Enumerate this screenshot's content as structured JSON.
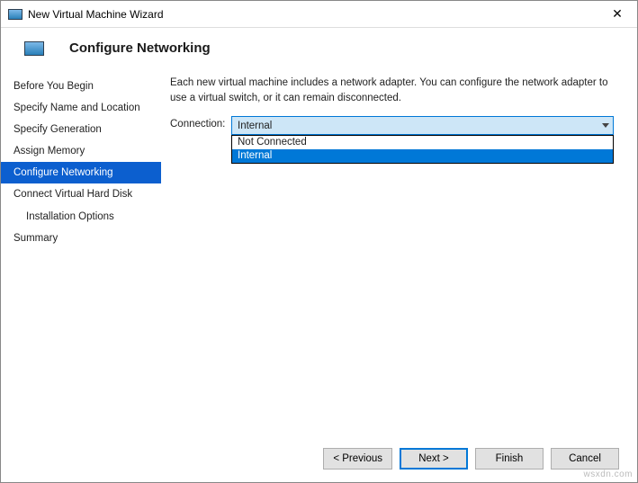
{
  "window": {
    "title": "New Virtual Machine Wizard",
    "close": "✕"
  },
  "header": {
    "title": "Configure Networking"
  },
  "sidebar": {
    "items": [
      {
        "label": "Before You Begin"
      },
      {
        "label": "Specify Name and Location"
      },
      {
        "label": "Specify Generation"
      },
      {
        "label": "Assign Memory"
      },
      {
        "label": "Configure Networking"
      },
      {
        "label": "Connect Virtual Hard Disk"
      },
      {
        "label": "Installation Options"
      },
      {
        "label": "Summary"
      }
    ],
    "active_index": 4,
    "sub_index": 6
  },
  "content": {
    "description": "Each new virtual machine includes a network adapter. You can configure the network adapter to use a virtual switch, or it can remain disconnected.",
    "connection_label": "Connection:",
    "selected": "Internal",
    "options": [
      {
        "label": "Not Connected"
      },
      {
        "label": "Internal"
      }
    ],
    "highlight_index": 1
  },
  "footer": {
    "previous": "< Previous",
    "next": "Next >",
    "finish": "Finish",
    "cancel": "Cancel"
  },
  "watermark": "wsxdn.com"
}
